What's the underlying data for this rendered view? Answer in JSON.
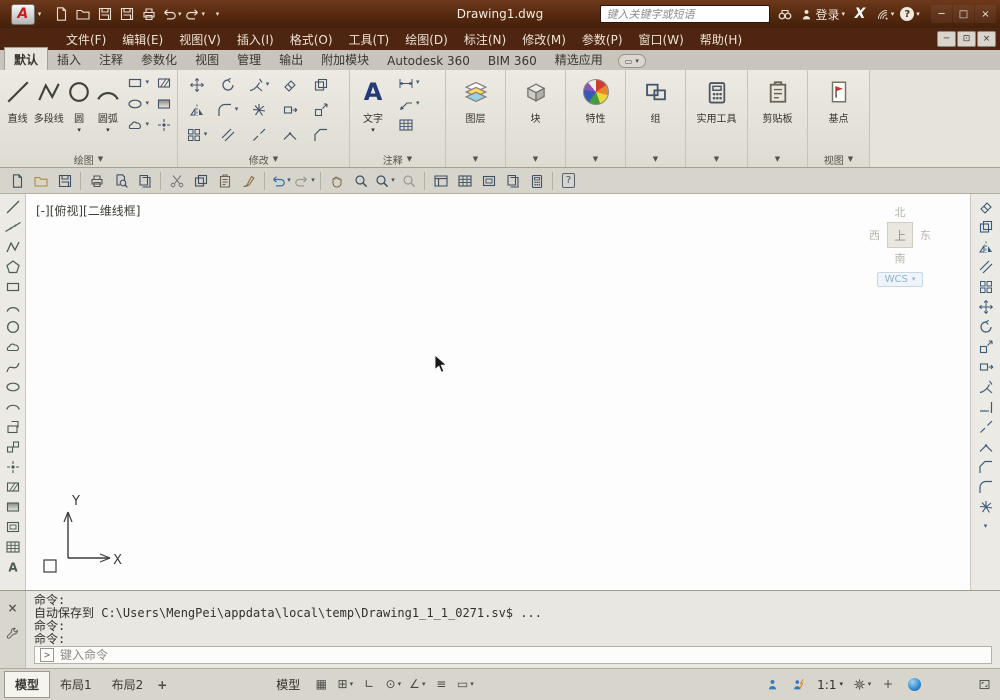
{
  "title_bar": {
    "logo": "A",
    "title": "Drawing1.dwg",
    "search_placeholder": "键入关键字或短语",
    "login_label": "登录",
    "exchange_label": "X",
    "help_label": "?"
  },
  "menu_bar": {
    "items": [
      "文件(F)",
      "编辑(E)",
      "视图(V)",
      "插入(I)",
      "格式(O)",
      "工具(T)",
      "绘图(D)",
      "标注(N)",
      "修改(M)",
      "参数(P)",
      "窗口(W)",
      "帮助(H)"
    ]
  },
  "ribbon": {
    "tabs": [
      "默认",
      "插入",
      "注释",
      "参数化",
      "视图",
      "管理",
      "输出",
      "附加模块",
      "Autodesk 360",
      "BIM 360",
      "精选应用"
    ],
    "draw_buttons": [
      "直线",
      "多段线",
      "圆",
      "圆弧"
    ],
    "text_button": "文字",
    "big_buttons": [
      "图层",
      "块",
      "特性",
      "组",
      "实用工具",
      "剪贴板",
      "基点"
    ],
    "footers": {
      "draw": "绘图",
      "modify": "修改",
      "annotate": "注释",
      "view": "视图"
    }
  },
  "viewport": {
    "label": "[-][俯视][二维线框]",
    "viewcube": {
      "north": "北",
      "west": "西",
      "east": "东",
      "south": "南",
      "top": "上",
      "wcs": "WCS"
    },
    "ucs": {
      "x_label": "X",
      "y_label": "Y"
    }
  },
  "command": {
    "lines": [
      "命令:",
      "自动保存到 C:\\Users\\MengPei\\appdata\\local\\temp\\Drawing1_1_1_0271.sv$ ...",
      "命令:",
      "命令:"
    ],
    "input_hint": "键入命令"
  },
  "status_bar": {
    "layout_tabs": [
      "模型",
      "布局1",
      "布局2"
    ],
    "model_button": "模型",
    "annotation_scale": "1:1"
  }
}
